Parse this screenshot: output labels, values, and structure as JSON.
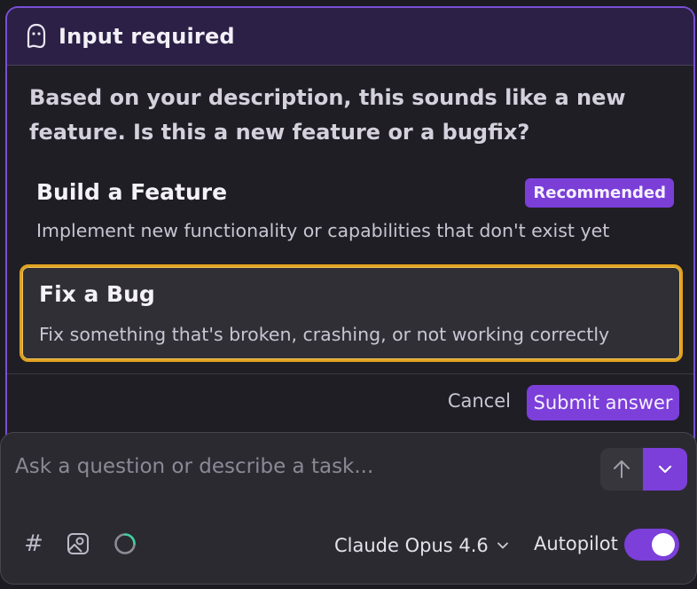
{
  "header": {
    "title": "Input required",
    "icon": "ghost-icon"
  },
  "question": "Based on your description, this sounds like a new feature. Is this a new feature or a bugfix?",
  "options": [
    {
      "title": "Build a Feature",
      "description": "Implement new functionality or capabilities that don't exist yet",
      "badge": "Recommended",
      "selected": false
    },
    {
      "title": "Fix a Bug",
      "description": "Fix something that's broken, crashing, or not working correctly",
      "selected": true
    }
  ],
  "actions": {
    "cancel_label": "Cancel",
    "submit_label": "Submit answer"
  },
  "composer": {
    "placeholder": "Ask a question or describe a task...",
    "hash_symbol": "#",
    "model": "Claude Opus 4.6",
    "autopilot_label": "Autopilot",
    "autopilot_on": true
  },
  "colors": {
    "accent": "#7c3fd9",
    "selected_border": "#e0a21f",
    "header_bg": "#2c2046",
    "panel_bg": "#1f1e25",
    "composer_bg": "#2b2a31"
  }
}
